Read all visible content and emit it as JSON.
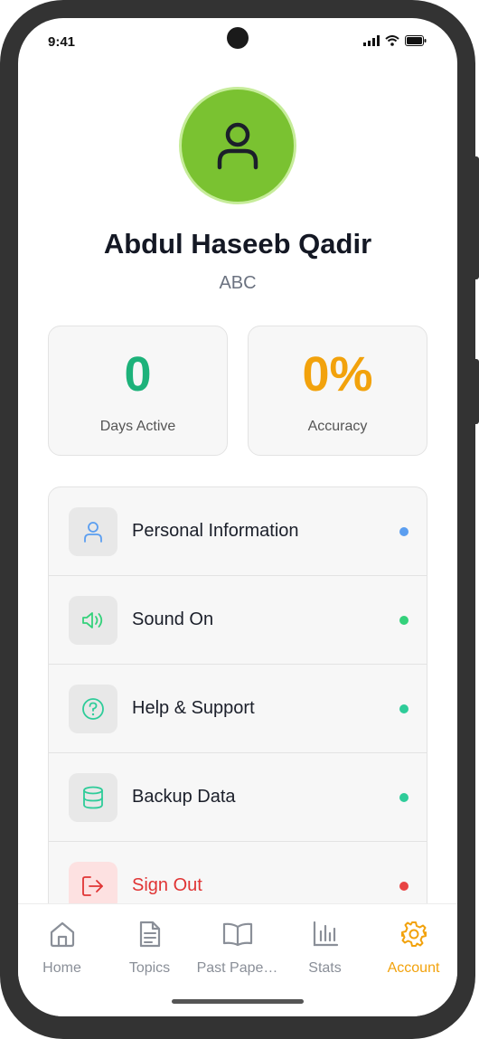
{
  "status_bar": {
    "time": "9:41"
  },
  "profile": {
    "name": "Abdul Haseeb Qadir",
    "subtitle": "ABC",
    "avatar_icon": "user-icon",
    "avatar_color": "#7ac231"
  },
  "stats": [
    {
      "value": "0",
      "label": "Days Active",
      "color": "#1db27a"
    },
    {
      "value": "0%",
      "label": "Accuracy",
      "color": "#f2a20c"
    }
  ],
  "menu": [
    {
      "label": "Personal Information",
      "icon": "user-icon",
      "dot_color": "#5b9ef0"
    },
    {
      "label": "Sound On",
      "icon": "speaker-icon",
      "dot_color": "#34d17b"
    },
    {
      "label": "Help & Support",
      "icon": "help-circle-icon",
      "dot_color": "#2ecc99"
    },
    {
      "label": "Backup Data",
      "icon": "database-icon",
      "dot_color": "#2ecc99"
    },
    {
      "label": "Sign Out",
      "icon": "logout-icon",
      "dot_color": "#e84343"
    }
  ],
  "nav": [
    {
      "label": "Home",
      "icon": "home-icon",
      "active": false
    },
    {
      "label": "Topics",
      "icon": "document-icon",
      "active": false
    },
    {
      "label": "Past Pape…",
      "icon": "book-open-icon",
      "active": false
    },
    {
      "label": "Stats",
      "icon": "bar-chart-icon",
      "active": false
    },
    {
      "label": "Account",
      "icon": "gear-icon",
      "active": true
    }
  ],
  "colors": {
    "accent": "#f2a20c",
    "danger": "#e03434"
  }
}
